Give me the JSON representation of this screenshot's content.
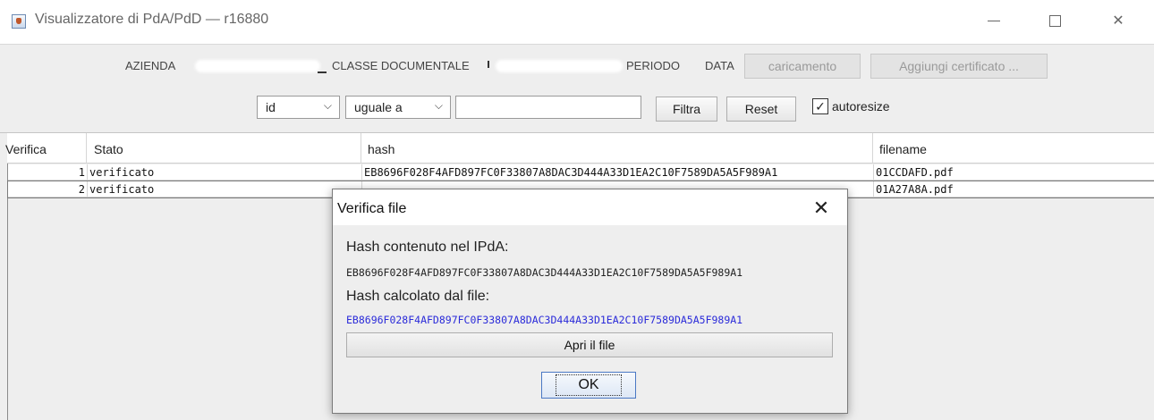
{
  "window": {
    "title": "Visualizzatore di PdA/PdD — r16880",
    "icons": {
      "app": "java-cup-icon",
      "minimize": "minimize-icon",
      "maximize": "maximize-icon",
      "close": "close-icon"
    },
    "close_glyph": "✕"
  },
  "toolbar": {
    "azienda_label": "AZIENDA",
    "classe_label": "CLASSE DOCUMENTALE",
    "periodo_label": "PERIODO",
    "data_label": "DATA",
    "caricamento_label": "caricamento",
    "aggiungi_label": "Aggiungi certificato ..."
  },
  "filter": {
    "field_select": "id",
    "operator_select": "uguale a",
    "value": "",
    "filtra_label": "Filtra",
    "reset_label": "Reset",
    "autoresize_label": "autoresize",
    "autoresize_checked": true,
    "check_glyph": "✓",
    "chevron_glyph": "⌵"
  },
  "table": {
    "columns": [
      "Verifica",
      "Stato",
      "hash",
      "filename"
    ],
    "rows": [
      {
        "num": "1",
        "stato": "verificato",
        "hash": "EB8696F028F4AFD897FC0F33807A8DAC3D444A33D1EA2C10F7589DA5A5F989A1",
        "filename": "01CCDAFD.pdf"
      },
      {
        "num": "2",
        "stato": "verificato",
        "hash": "",
        "filename": "01A27A8A.pdf"
      }
    ]
  },
  "dialog": {
    "title": "Verifica file",
    "close_glyph": "✕",
    "hash_ipda_label": "Hash contenuto nel IPdA:",
    "hash_ipda_value": "EB8696F028F4AFD897FC0F33807A8DAC3D444A33D1EA2C10F7589DA5A5F989A1",
    "hash_file_label": "Hash calcolato dal file:",
    "hash_file_value": "EB8696F028F4AFD897FC0F33807A8DAC3D444A33D1EA2C10F7589DA5A5F989A1",
    "apri_label": "Apri il file",
    "ok_label": "OK",
    "match_color": "#2b2bd9"
  }
}
